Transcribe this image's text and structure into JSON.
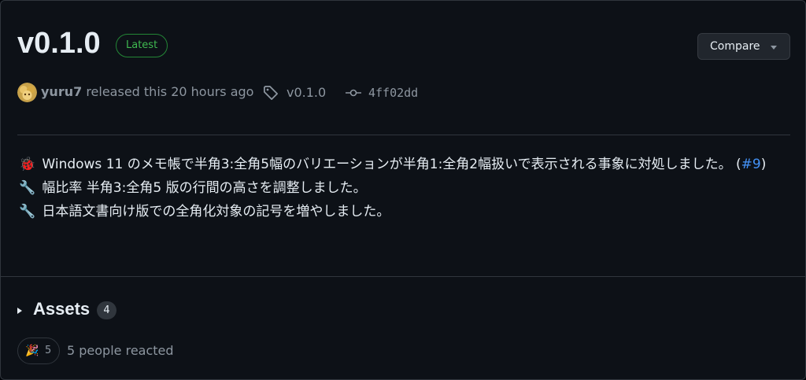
{
  "release": {
    "title": "v0.1.0",
    "badge": "Latest",
    "compare_label": "Compare"
  },
  "meta": {
    "user": "yuru7",
    "released_text": " released this 20 hours ago",
    "tag": "v0.1.0",
    "commit": "4ff02dd"
  },
  "notes": {
    "line1_text": "Windows 11 のメモ帳で半角3:全角5幅のバリエーションが半角1:全角2幅扱いで表示される事象に対処しました。 (",
    "line1_link": "#9",
    "line1_close": ")",
    "line2_text": "幅比率 半角3:全角5 版の行間の高さを調整しました。",
    "line3_text": "日本語文書向け版での全角化対象の記号を増やしました。",
    "icons": [
      "ladybug-icon",
      "wrench-icon",
      "wrench-icon"
    ]
  },
  "assets": {
    "label": "Assets",
    "count": "4"
  },
  "reactions": {
    "count": "5",
    "summary": "5 people reacted",
    "icon": "party-popper-icon"
  },
  "colors": {
    "background": "#0d1117",
    "border": "#30363d",
    "latest_green": "#3fb950",
    "link_blue": "#4493f8",
    "muted": "#8d96a0"
  }
}
